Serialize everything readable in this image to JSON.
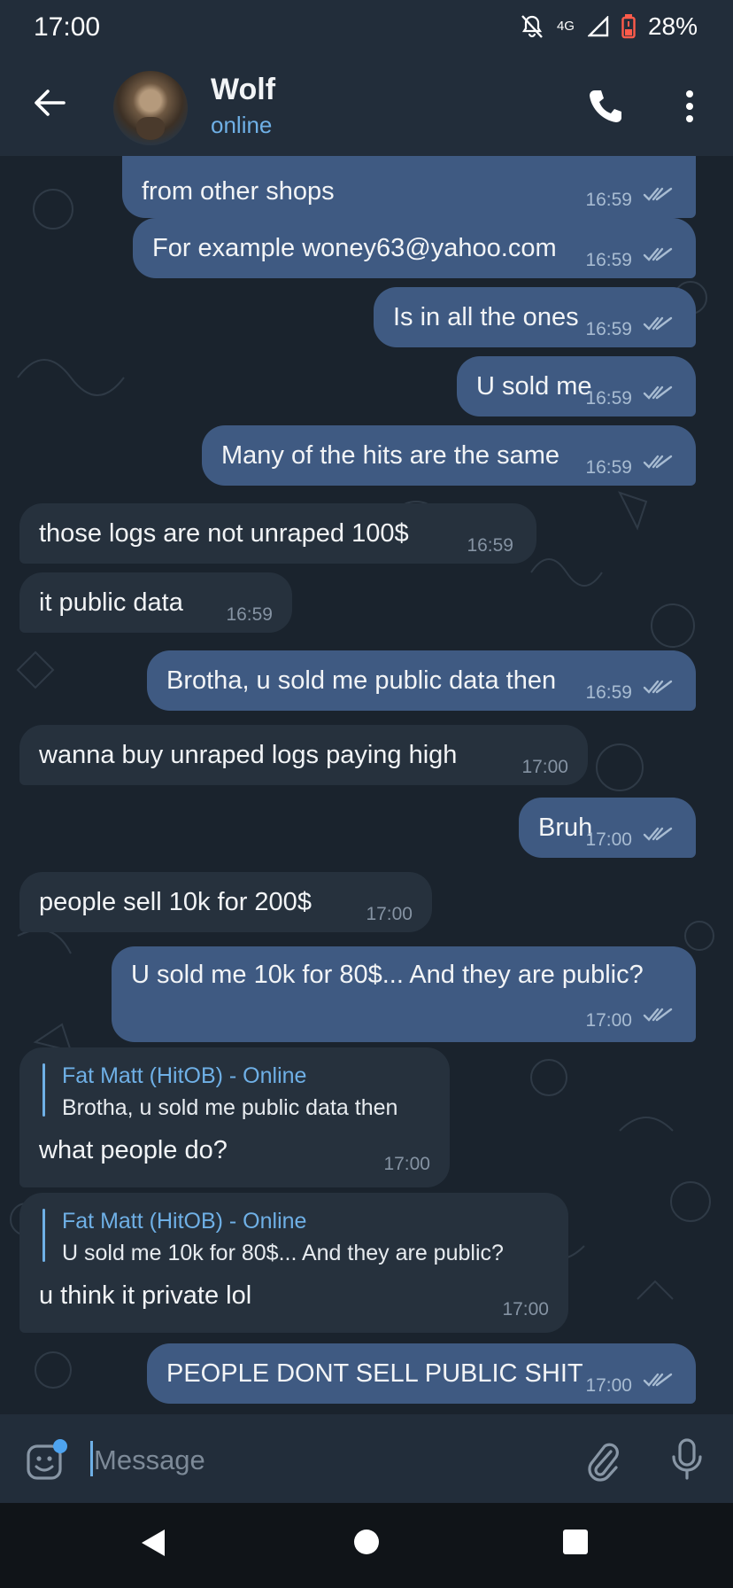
{
  "status_bar": {
    "time": "17:00",
    "network": "4G",
    "battery": "28%"
  },
  "header": {
    "name": "Wolf",
    "status": "online"
  },
  "messages": [
    {
      "dir": "out",
      "text": "from other shops",
      "time": "16:59"
    },
    {
      "dir": "out",
      "text": "For example woney63@yahoo.com",
      "time": "16:59"
    },
    {
      "dir": "out",
      "text": "Is in all the ones",
      "time": "16:59"
    },
    {
      "dir": "out",
      "text": "U sold me",
      "time": "16:59"
    },
    {
      "dir": "out",
      "text": "Many of the hits are the same",
      "time": "16:59"
    },
    {
      "dir": "in",
      "text": "those logs are not unraped 100$",
      "time": "16:59"
    },
    {
      "dir": "in",
      "text": "it public data",
      "time": "16:59"
    },
    {
      "dir": "out",
      "text": "Brotha, u sold me public data then",
      "time": "16:59"
    },
    {
      "dir": "in",
      "text": "wanna buy unraped logs paying high",
      "time": "17:00"
    },
    {
      "dir": "out",
      "text": "Bruh",
      "time": "17:00"
    },
    {
      "dir": "in",
      "text": "people sell 10k for 200$",
      "time": "17:00"
    },
    {
      "dir": "out",
      "text": "U sold me 10k for 80$... And they are public?",
      "time": "17:00"
    },
    {
      "dir": "in",
      "text": "what people do?",
      "time": "17:00",
      "reply_name": "Fat Matt (HitOB) - Online",
      "reply_text": "Brotha, u sold me public data then"
    },
    {
      "dir": "in",
      "text": "u think it private lol",
      "time": "17:00",
      "reply_name": "Fat Matt (HitOB) - Online",
      "reply_text": "U sold me 10k for 80$... And they are public?"
    },
    {
      "dir": "out",
      "text": "PEOPLE DONT SELL PUBLIC SHIT",
      "time": "17:00"
    }
  ],
  "input": {
    "placeholder": "Message"
  },
  "colors": {
    "outgoing": "#3f5a82",
    "incoming": "#26313d",
    "accent": "#6fb0e6",
    "background": "#1a232d"
  },
  "icons": [
    "back-arrow-icon",
    "phone-icon",
    "more-vertical-icon",
    "emoji-icon",
    "attach-icon",
    "mic-icon",
    "read-ticks-icon"
  ]
}
